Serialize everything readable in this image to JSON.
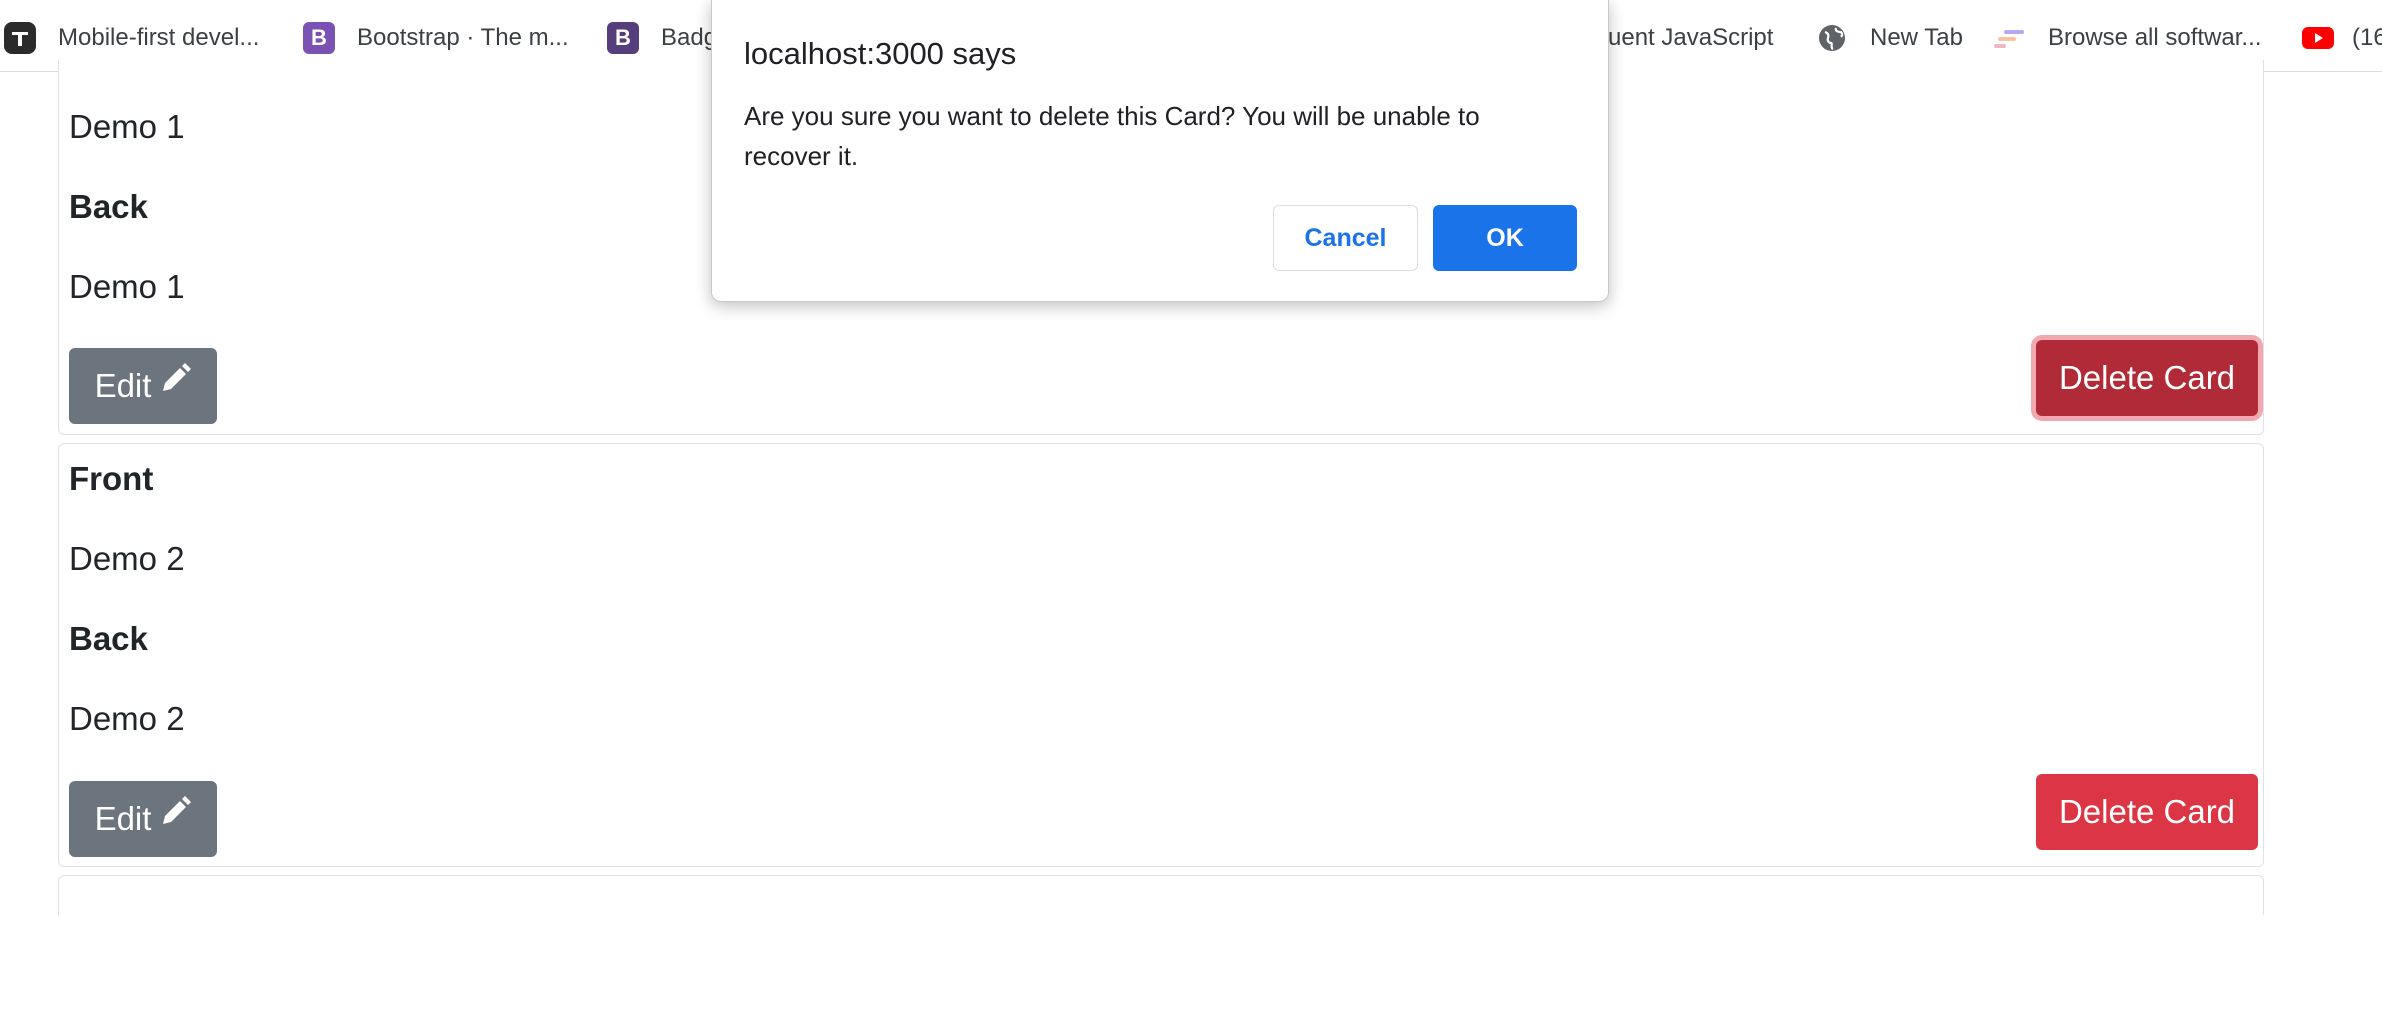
{
  "bookmarks": [
    {
      "label": "Mobile-first devel...",
      "icon": "typescript-logo-icon",
      "glyph": "T"
    },
    {
      "label": "Bootstrap · The m...",
      "icon": "bootstrap-logo-icon",
      "glyph": "B"
    },
    {
      "label": "Badg",
      "icon": "bootstrap-badge-logo-icon",
      "glyph": "B"
    },
    {
      "label": "uent JavaScript",
      "icon": "",
      "glyph": ""
    },
    {
      "label": "New Tab",
      "icon": "globe-icon",
      "glyph": ""
    },
    {
      "label": "Browse all softwar...",
      "icon": "software-logo-icon",
      "glyph": ""
    },
    {
      "label": "(16",
      "icon": "youtube-icon",
      "glyph": ""
    }
  ],
  "cards": [
    {
      "front_value": "Demo 1",
      "back_label": "Back",
      "back_value": "Demo 1",
      "edit_label": "Edit",
      "delete_label": "Delete Card",
      "delete_focused": true
    },
    {
      "front_label": "Front",
      "front_value": "Demo 2",
      "back_label": "Back",
      "back_value": "Demo 2",
      "edit_label": "Edit",
      "delete_label": "Delete Card",
      "delete_focused": false
    }
  ],
  "dialog": {
    "title": "localhost:3000 says",
    "message": "Are you sure you want to delete this Card? You will be unable to recover it.",
    "cancel_label": "Cancel",
    "ok_label": "OK"
  },
  "colors": {
    "edit_button": "#6c757d",
    "delete_button": "#dc3545",
    "delete_button_active": "#b02a37",
    "dialog_ok": "#1a73e8"
  }
}
